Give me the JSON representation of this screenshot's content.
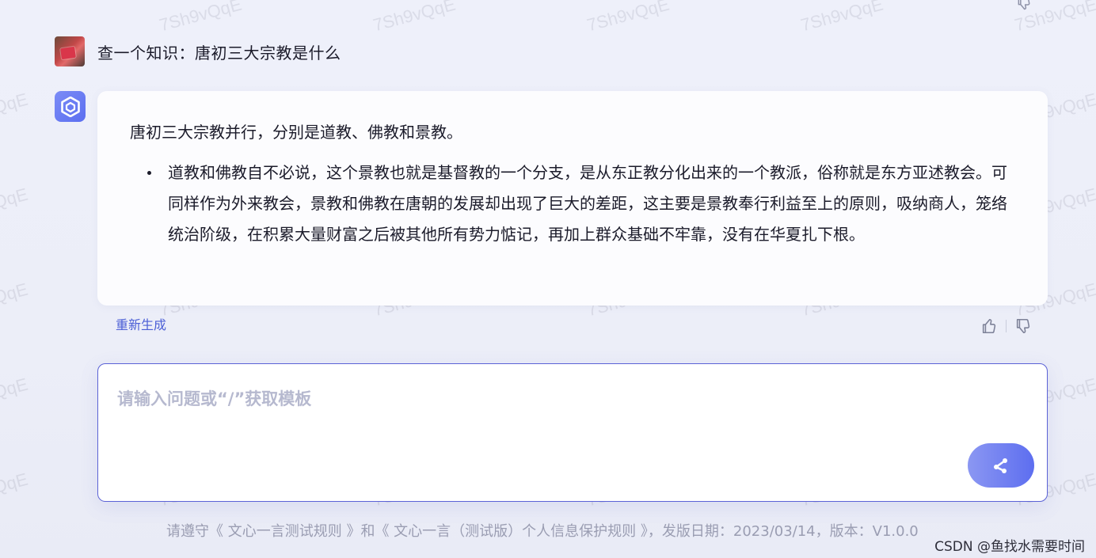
{
  "watermark": "7Sh9vQqE",
  "conversation": {
    "user_message": "查一个知识：唐初三大宗教是什么",
    "answer_intro": "唐初三大宗教并行，分别是道教、佛教和景教。",
    "answer_bullets": [
      "道教和佛教自不必说，这个景教也就是基督教的一个分支，是从东正教分化出来的一个教派，俗称就是东方亚述教会。可同样作为外来教会，景教和佛教在唐朝的发展却出现了巨大的差距，这主要是景教奉行利益至上的原则，吸纳商人，笼络统治阶级，在积累大量财富之后被其他所有势力惦记，再加上群众基础不牢靠，没有在华夏扎下根。"
    ],
    "regenerate_label": "重新生成"
  },
  "input": {
    "placeholder": "请输入问题或“/”获取模板"
  },
  "footer": {
    "notice": "请遵守《 文心一言测试规则 》和《 文心一言（测试版）个人信息保护规则 》，发版日期：2023/03/14，版本：V1.0.0"
  },
  "credit": "CSDN @鱼找水需要时间",
  "colors": {
    "accent": "#4c5fd6",
    "input_border": "#5b62d6",
    "send_gradient_start": "#8b97f2",
    "send_gradient_end": "#5d6ef0"
  },
  "icons": {
    "thumbs_up": "thumbs-up-icon",
    "thumbs_down": "thumbs-down-icon",
    "send": "send-icon",
    "bot_logo": "ernie-bot-logo-icon"
  }
}
